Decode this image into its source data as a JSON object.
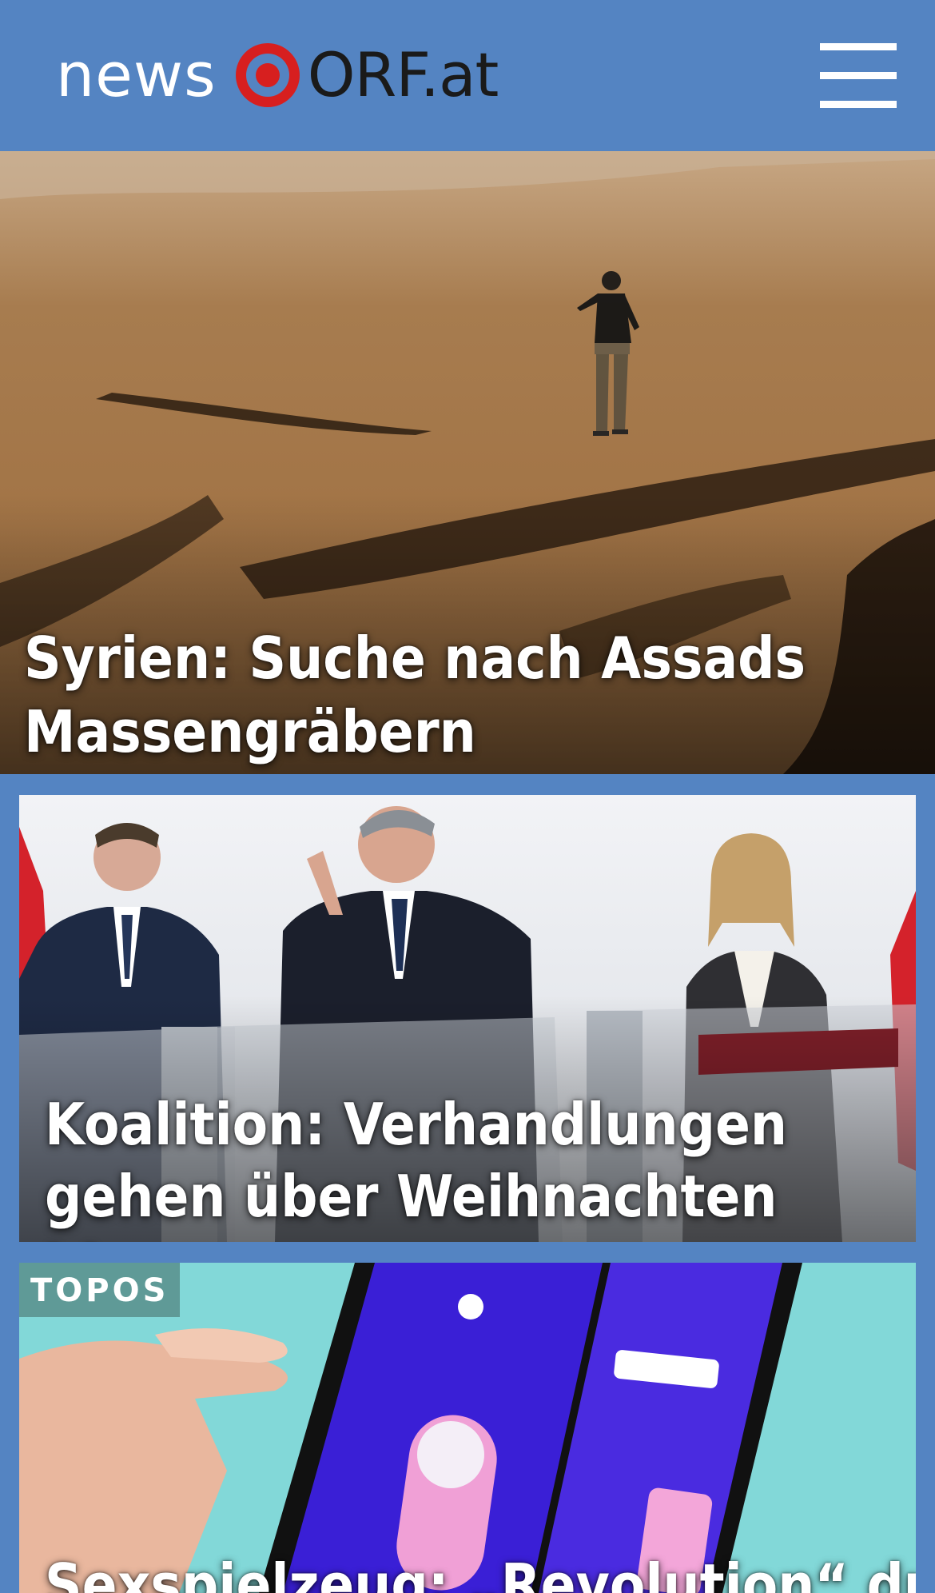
{
  "header": {
    "logo_word": "news",
    "logo_brand": "ORF.at",
    "menu_icon": "hamburger-menu-icon"
  },
  "colors": {
    "header_bg": "#5484c2",
    "logo_red": "#d71f1f",
    "badge_bg": "#5f9a97"
  },
  "teasers": [
    {
      "headline": "Syrien: Suche nach Assads Massengräbern"
    },
    {
      "headline": "Koalition: Verhandlungen gehen über Weihnachten hinaus"
    },
    {
      "badge": "TOPOS",
      "headline": "Sexspielzeug: „Revolution“ durch"
    }
  ]
}
